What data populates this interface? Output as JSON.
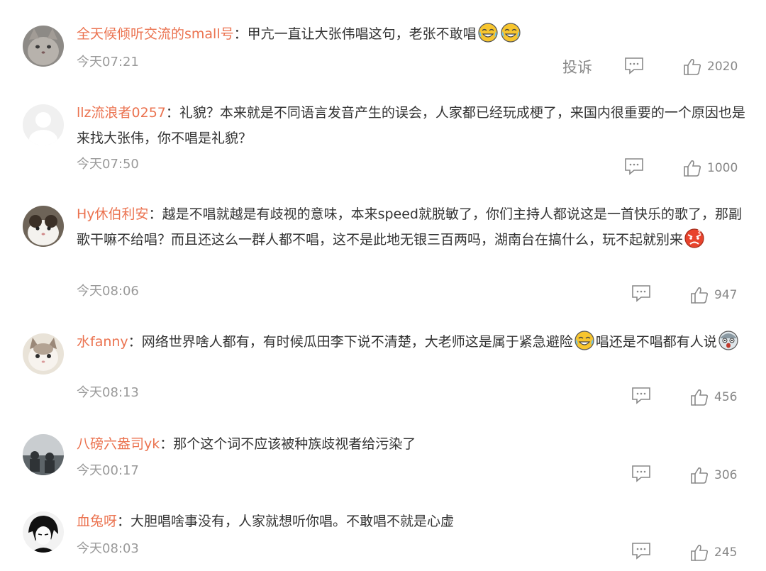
{
  "comments": [
    {
      "user": "全天候倾听交流的small号",
      "colon": "：",
      "text": "甲亢一直让大张伟唱这句，老张不敢唱",
      "text2": "",
      "time": "今天07:21",
      "report": "投诉",
      "likes": "2020",
      "avatar_icon": "cat-avatar-icon",
      "emojis": [
        "laugh-cry-emoji-icon",
        "laugh-cry-emoji-icon"
      ]
    },
    {
      "user": "llz流浪者0257",
      "colon": "：",
      "text": "礼貌？本来就是不同语言发音产生的误会，人家都已经玩成梗了，来国内很重要的一个原因也是来找大张伟，你不唱是礼貌？",
      "text2": "",
      "time": "今天07:50",
      "likes": "1000",
      "avatar_icon": "default-avatar-icon",
      "emojis": []
    },
    {
      "user": "Hy休伯利安",
      "colon": "：",
      "text": "越是不唱就越是有歧视的意味，本来speed就脱敏了，你们主持人都说这是一首快乐的歌了，那副歌干嘛不给唱？而且还这么一群人都不唱，这不是此地无银三百两吗，湖南台在搞什么，玩不起就别来",
      "text2": "",
      "time": "今天08:06",
      "likes": "947",
      "avatar_icon": "cat-avatar-icon",
      "emojis": [
        "angry-emoji-icon"
      ]
    },
    {
      "user": "水fanny",
      "colon": "：",
      "text": "网络世界啥人都有，有时候瓜田李下说不清楚，大老师这是属于紧急避险",
      "text2": "唱还是不唱都有人说",
      "time": "今天08:13",
      "likes": "456",
      "avatar_icon": "cat-avatar-icon",
      "emojis": [
        "laugh-cry-emoji-icon",
        "scared-emoji-icon"
      ]
    },
    {
      "user": "八磅六盎司yk",
      "colon": "：",
      "text": "那个这个词不应该被种族歧视者给污染了",
      "text2": "",
      "time": "今天00:17",
      "likes": "306",
      "avatar_icon": "people-avatar-icon",
      "emojis": []
    },
    {
      "user": "血兔呀",
      "colon": "：",
      "text": "大胆唱啥事没有，人家就想听你唱。不敢唱不就是心虚",
      "text2": "",
      "time": "今天08:03",
      "likes": "245",
      "avatar_icon": "anime-avatar-icon",
      "emojis": []
    }
  ],
  "icons": {
    "reply": "comment-reply-icon",
    "like": "thumbs-up-icon"
  },
  "colors": {
    "username": "#eb7350",
    "text": "#333333",
    "meta": "#9a9a9a"
  }
}
